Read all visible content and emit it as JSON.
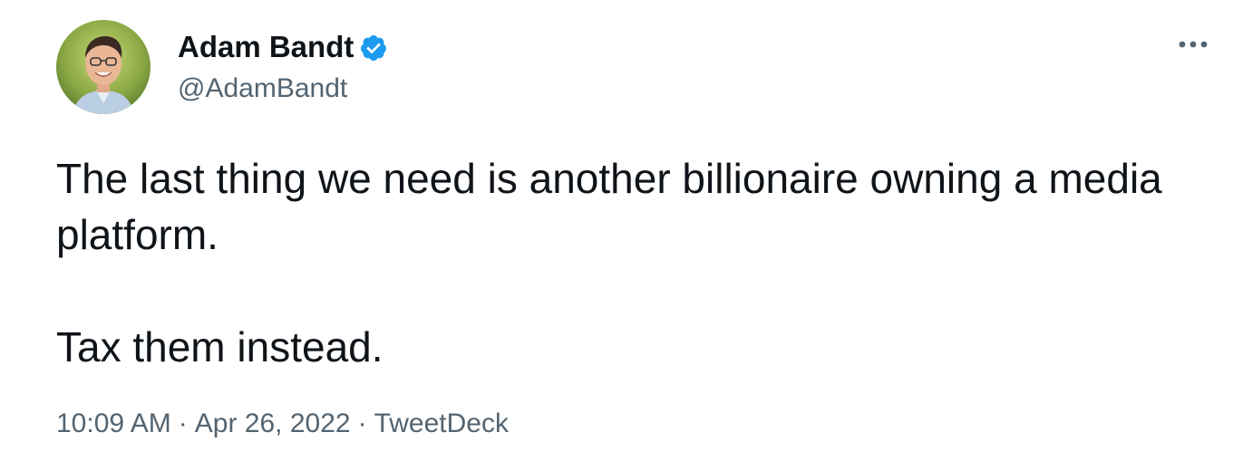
{
  "author": {
    "display_name": "Adam Bandt",
    "handle": "@AdamBandt",
    "verified": true,
    "verified_color": "#1d9bf0"
  },
  "tweet": {
    "lines": [
      "The last thing we need is another billionaire owning a media platform.",
      "Tax them instead."
    ],
    "time": "10:09 AM",
    "separator": "·",
    "date": "Apr 26, 2022",
    "source": "TweetDeck"
  },
  "icons": {
    "more": "more-icon",
    "verified": "verified-badge-icon"
  },
  "colors": {
    "text": "#0f1419",
    "secondary": "#536471",
    "background": "#ffffff"
  }
}
